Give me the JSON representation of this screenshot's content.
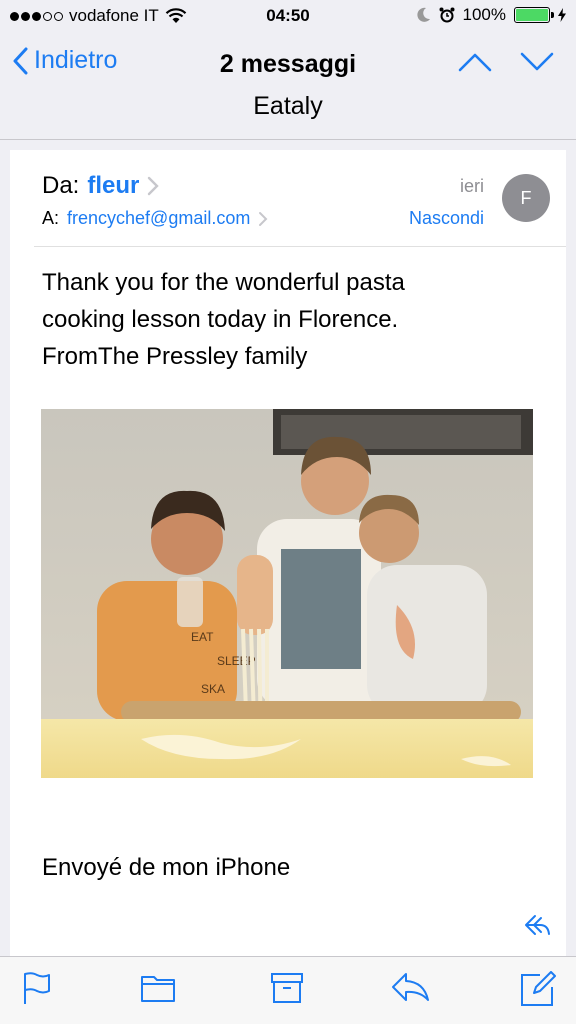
{
  "status_bar": {
    "carrier": "vodafone IT",
    "time": "04:50",
    "battery": "100%",
    "battery_level": 1.0
  },
  "nav": {
    "back_label": "Indietro",
    "message_count": "2 messaggi",
    "title": "Eataly"
  },
  "email": {
    "from_label": "Da:",
    "from_name": "fleur",
    "to_label": "A:",
    "to_address": "frencychef@gmail.com",
    "date": "ieri",
    "hide_label": "Nascondi",
    "avatar_initial": "F",
    "body_lines": [
      "Thank you for the wonderful pasta",
      "cooking lesson today in Florence.",
      "FromThe Pressley family"
    ],
    "signature": "Envoyé de mon iPhone",
    "photo_text": [
      "EAT",
      "SLEEP",
      "SKA"
    ]
  },
  "colors": {
    "accent": "#1d7cf2",
    "battery": "#4cd964",
    "avatar": "#8e8e93"
  },
  "toolbar": {
    "icons": [
      "flag-icon",
      "folder-icon",
      "archive-icon",
      "reply-icon",
      "compose-icon"
    ]
  }
}
